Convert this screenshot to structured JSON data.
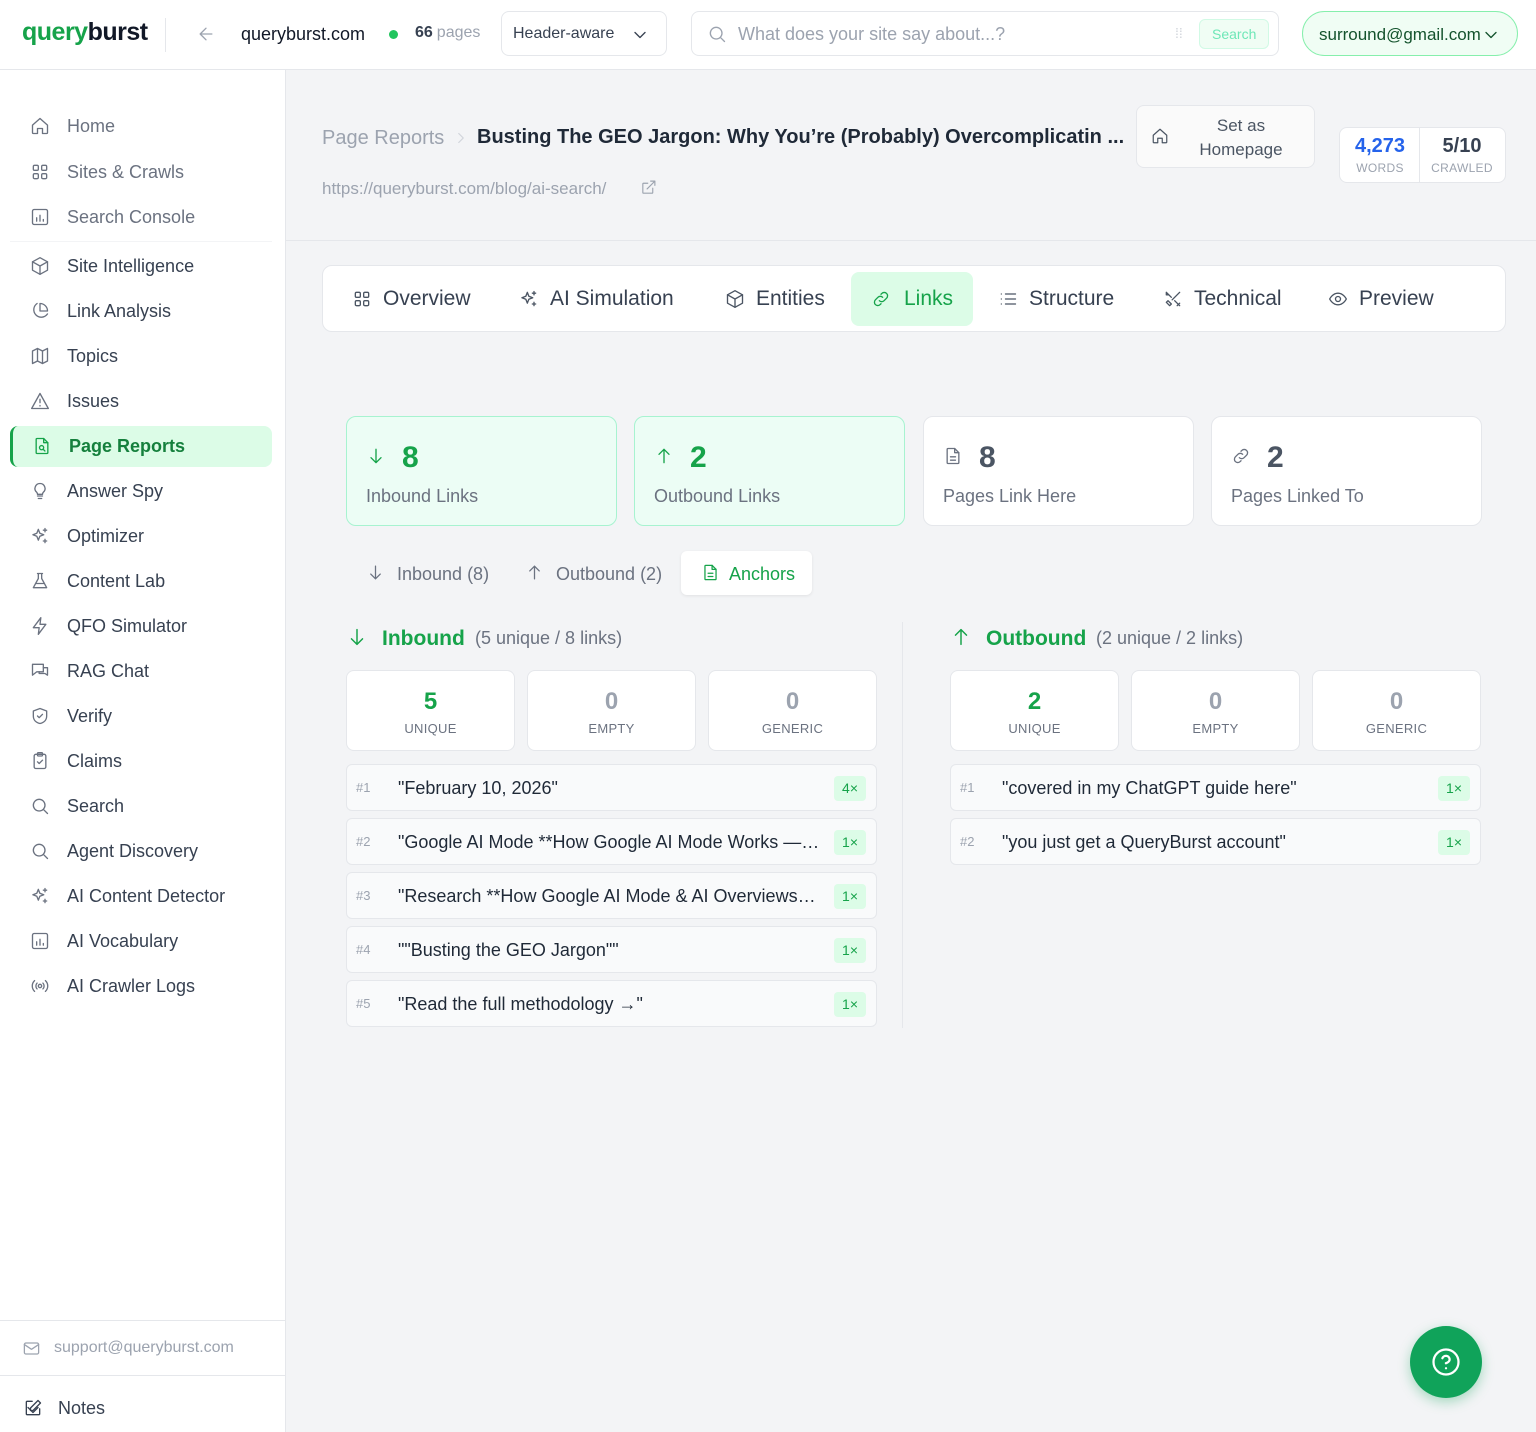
{
  "app": {
    "brand_a": "query",
    "brand_b": "burst"
  },
  "topbar": {
    "domain": "queryburst.com",
    "page_count": "66",
    "page_count_unit": "pages",
    "header_mode": "Header-aware",
    "search_placeholder": "What does your site say about...?",
    "search_kbd": "⁞⁞",
    "search_button": "Search",
    "account": "surround@gmail.com"
  },
  "sidebar": {
    "items": [
      {
        "label": "Home",
        "icon": "home-icon"
      },
      {
        "label": "Sites & Crawls",
        "icon": "grid-icon"
      },
      {
        "label": "Search Console",
        "icon": "bar-chart-icon"
      },
      {
        "label": "Site Intelligence",
        "icon": "box-icon"
      },
      {
        "label": "Link Analysis",
        "icon": "pie-chart-icon"
      },
      {
        "label": "Topics",
        "icon": "map-icon"
      },
      {
        "label": "Issues",
        "icon": "alert-triangle-icon"
      },
      {
        "label": "Page Reports",
        "icon": "file-search-icon"
      },
      {
        "label": "Answer Spy",
        "icon": "lightbulb-icon"
      },
      {
        "label": "Optimizer",
        "icon": "sparkles-icon"
      },
      {
        "label": "Content Lab",
        "icon": "flask-icon"
      },
      {
        "label": "QFO Simulator",
        "icon": "zap-icon"
      },
      {
        "label": "RAG Chat",
        "icon": "messages-icon"
      },
      {
        "label": "Verify",
        "icon": "shield-check-icon"
      },
      {
        "label": "Claims",
        "icon": "clipboard-icon"
      },
      {
        "label": "Search",
        "icon": "search-icon"
      },
      {
        "label": "Agent Discovery",
        "icon": "search-icon"
      },
      {
        "label": "AI Content Detector",
        "icon": "sparkles-icon"
      },
      {
        "label": "AI Vocabulary",
        "icon": "bar-chart-icon"
      },
      {
        "label": "AI Crawler Logs",
        "icon": "radio-icon"
      }
    ],
    "support_email": "support@queryburst.com",
    "notes_label": "Notes"
  },
  "page": {
    "breadcrumb_parent": "Page Reports",
    "title": "Busting The GEO Jargon: Why You’re (Probably) Overcomplicating AI Search",
    "url": "https://queryburst.com/blog/ai-search/",
    "set_homepage": "Set as Homepage",
    "words_value": "4,273",
    "words_label": "WORDS",
    "crawled_value": "5/10",
    "crawled_label": "CRAWLED",
    "colors": {
      "accent": "#16a34a",
      "words": "#2563eb"
    }
  },
  "tabs": [
    "Overview",
    "AI Simulation",
    "Entities",
    "Links",
    "Structure",
    "Technical",
    "Preview"
  ],
  "cards": [
    {
      "value": "8",
      "label": "Inbound Links"
    },
    {
      "value": "2",
      "label": "Outbound Links"
    },
    {
      "value": "8",
      "label": "Pages Link Here"
    },
    {
      "value": "2",
      "label": "Pages Linked To"
    }
  ],
  "subtabs": [
    "Inbound (8)",
    "Outbound (2)",
    "Anchors"
  ],
  "inbound": {
    "title": "Inbound",
    "summary": "(5 unique / 8 links)",
    "stats": [
      {
        "value": "5",
        "label": "UNIQUE"
      },
      {
        "value": "0",
        "label": "EMPTY"
      },
      {
        "value": "0",
        "label": "GENERIC"
      }
    ],
    "anchors": [
      {
        "rank": "#1",
        "text": "\"February 10, 2026\"",
        "count": "4×"
      },
      {
        "rank": "#2",
        "text": "\"Google AI Mode **How Google AI Mode Works —…",
        "count": "1×"
      },
      {
        "rank": "#3",
        "text": "\"Research **How Google AI Mode & AI Overviews …",
        "count": "1×"
      },
      {
        "rank": "#4",
        "text": "\"\"Busting the GEO Jargon\"\"",
        "count": "1×"
      },
      {
        "rank": "#5",
        "text": "\"Read the full methodology →\"",
        "count": "1×"
      }
    ]
  },
  "outbound": {
    "title": "Outbound",
    "summary": "(2 unique / 2 links)",
    "stats": [
      {
        "value": "2",
        "label": "UNIQUE"
      },
      {
        "value": "0",
        "label": "EMPTY"
      },
      {
        "value": "0",
        "label": "GENERIC"
      }
    ],
    "anchors": [
      {
        "rank": "#1",
        "text": "\"covered in my ChatGPT guide here\"",
        "count": "1×"
      },
      {
        "rank": "#2",
        "text": "\"you just get a QueryBurst account\"",
        "count": "1×"
      }
    ]
  }
}
